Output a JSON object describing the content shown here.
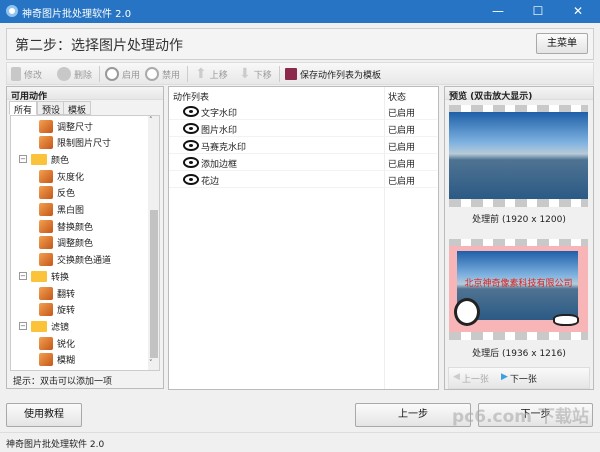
{
  "window": {
    "title": "神奇图片批处理软件 2.0",
    "minimize": "—",
    "maximize": "☐",
    "close": "✕"
  },
  "header": {
    "step_title": "第二步：选择图片处理动作",
    "main_menu": "主菜单"
  },
  "toolbar": {
    "edit": "修改",
    "delete": "删除",
    "enable": "启用",
    "disable": "禁用",
    "move_up": "上移",
    "move_down": "下移",
    "save_template": "保存动作列表为模板"
  },
  "left": {
    "title": "可用动作",
    "tabs": [
      "所有",
      "预设",
      "模板"
    ],
    "tree": [
      {
        "label": "调整尺寸",
        "type": "item"
      },
      {
        "label": "限制图片尺寸",
        "type": "item"
      },
      {
        "label": "颜色",
        "type": "folder"
      },
      {
        "label": "灰度化",
        "type": "item"
      },
      {
        "label": "反色",
        "type": "item"
      },
      {
        "label": "黑白图",
        "type": "item"
      },
      {
        "label": "替换颜色",
        "type": "item"
      },
      {
        "label": "调整颜色",
        "type": "item"
      },
      {
        "label": "交换颜色通道",
        "type": "item"
      },
      {
        "label": "转换",
        "type": "folder"
      },
      {
        "label": "翻转",
        "type": "item"
      },
      {
        "label": "旋转",
        "type": "item"
      },
      {
        "label": "滤镜",
        "type": "folder"
      },
      {
        "label": "锐化",
        "type": "item"
      },
      {
        "label": "模糊",
        "type": "item"
      }
    ],
    "hint": "提示：双击可以添加一项"
  },
  "actions": {
    "col_name": "动作列表",
    "col_status": "状态",
    "rows": [
      {
        "name": "文字水印",
        "status": "已启用"
      },
      {
        "name": "图片水印",
        "status": "已启用"
      },
      {
        "name": "马赛克水印",
        "status": "已启用"
      },
      {
        "name": "添加边框",
        "status": "已启用"
      },
      {
        "name": "花边",
        "status": "已启用"
      }
    ]
  },
  "preview": {
    "title": "预览 (双击放大显示)",
    "before": "处理前 (1920 x 1200)",
    "after": "处理后 (1936 x 1216)",
    "watermark_text": "北京神奇像素科技有限公司",
    "prev": "上一张",
    "next": "下一张"
  },
  "footer": {
    "tutorial": "使用教程",
    "prev_step": "上一步",
    "next_step": "下一步"
  },
  "status_bar": "神奇图片批处理软件 2.0",
  "overlay_watermark": "pc6.com 下载站"
}
